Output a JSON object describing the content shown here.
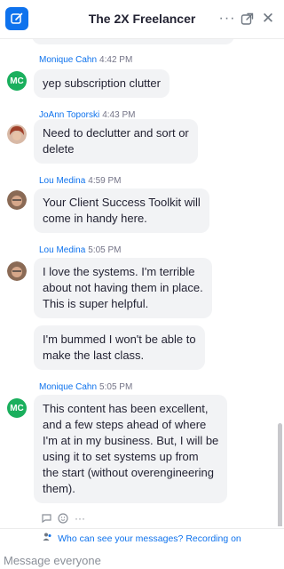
{
  "header": {
    "title": "The 2X Freelancer",
    "compose_icon": "compose-icon",
    "more_icon": "more-icon",
    "popout_icon": "popout-icon",
    "close_icon": "close-icon"
  },
  "messages": [
    {
      "sender": "Monique Cahn",
      "time": "4:42 PM",
      "avatar": "MC",
      "lines": [
        "yep subscription clutter"
      ]
    },
    {
      "sender": "JoAnn Toporski",
      "time": "4:43 PM",
      "avatar": "photo",
      "lines": [
        "Need to declutter and sort or",
        "delete"
      ]
    },
    {
      "sender": "Lou Medina",
      "time": "4:59 PM",
      "avatar": "photo",
      "lines": [
        "Your Client Success Toolkit will",
        "come in handy here."
      ]
    },
    {
      "sender": "Lou Medina",
      "time": "5:05 PM",
      "avatar": "photo",
      "lines": [
        "I love the systems. I'm terrible",
        "about not having them in place.",
        "This is super helpful."
      ]
    },
    {
      "sender": "",
      "time": "",
      "avatar": "",
      "lines": [
        "I'm bummed I won't be able to",
        "make the last class."
      ]
    },
    {
      "sender": "Monique Cahn",
      "time": "5:05 PM",
      "avatar": "MC",
      "lines": [
        "This content has been excellent,",
        "and a few steps ahead of where",
        "I'm at in my business. But, I will be",
        "using it to set systems up from",
        "the start (without overengineering",
        "them)."
      ]
    }
  ],
  "reaction_icons": [
    "reply-icon",
    "add-reaction-icon",
    "more-icon"
  ],
  "reaction_more": "···",
  "notice": {
    "who_can_see": "Who can see your messages?",
    "recording": "Recording on"
  },
  "input": {
    "placeholder": "Message everyone"
  },
  "colors": {
    "accent": "#0e72ed",
    "avatar_green": "#1aaf5d",
    "bubble": "#f2f3f5"
  }
}
